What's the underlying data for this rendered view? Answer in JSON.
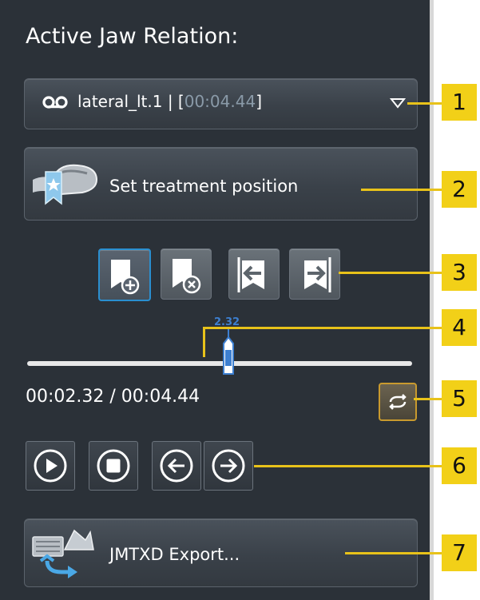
{
  "panel": {
    "title": "Active Jaw Relation:",
    "dropdown": {
      "tape_glyph": "σσ",
      "name": "lateral_lt.1 | [",
      "time": "00:04.44",
      "close": "]"
    },
    "set_treatment_label": "Set treatment position",
    "slider": {
      "value_label": "2.32",
      "value_fraction": 0.523
    },
    "timecode": "00:02.32 / 00:04.44",
    "export_label": "JMTXD Export..."
  },
  "icons": {
    "tape": "tape-icon",
    "dropdown": "triangle-down-icon",
    "treatment": "treatment-position-icon",
    "add_bookmark": "bookmark-add-icon",
    "remove_bookmark": "bookmark-remove-icon",
    "prev_bookmark": "bookmark-prev-icon",
    "next_bookmark": "bookmark-next-icon",
    "loop": "loop-icon",
    "play": "play-icon",
    "stop": "stop-icon",
    "step_back": "arrow-left-icon",
    "step_forward": "arrow-right-icon",
    "export": "jmtxd-export-icon"
  },
  "callouts": [
    "1",
    "2",
    "3",
    "4",
    "5",
    "6",
    "7"
  ],
  "colors": {
    "panel_bg": "#2b3138",
    "accent_blue": "#2a8fd0",
    "callout_yellow": "#f2d018",
    "loop_border": "#c99a2e"
  }
}
